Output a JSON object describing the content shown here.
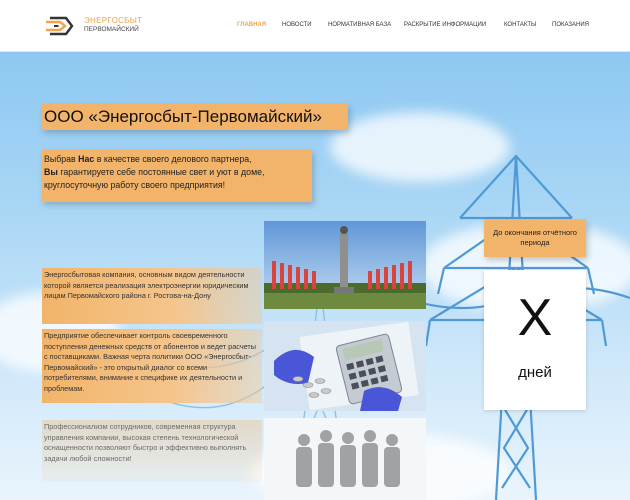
{
  "header": {
    "brand_line1": "ЭНЕРГОСБЫТ",
    "brand_line2": "ПЕРВОМАЙСКИЙ",
    "nav": [
      {
        "label": "ГЛАВНАЯ",
        "active": true
      },
      {
        "label": "НОВОСТИ"
      },
      {
        "label": "НОРМАТИВНАЯ БАЗА"
      },
      {
        "label": "РАСКРЫТИЕ ИНФОРМАЦИИ"
      },
      {
        "label": "КОНТАКТЫ"
      },
      {
        "label": "ПОКАЗАНИЯ"
      }
    ]
  },
  "hero": {
    "title": "ООО «Энергосбыт-Первомайский»",
    "intro": {
      "w1": "Выбрав ",
      "b1": "Нас",
      "w2": " в качестве своего делового партнера,",
      "b2": "Вы",
      "w3": " гарантируете себе постоянные свет и уют в доме, круглосуточную работу своего предприятия!"
    },
    "p1": "Энергосбытовая компания, основным видом деятельности которой является реализация электроэнергии юридическим лицам Первомайского района г. Ростова-на-Дону",
    "p2": "Предприятие обеспечивает контроль своевременного поступления денежных средств от абонентов и ведет расчеты с поставщиками. Важная черта политики ООО «Энергосбыт-Первомайский» - это открытый диалог со всеми потребителями, внимание к специфике их деятельности и проблемам.",
    "p3": "Профессионализм сотрудников, современная структура управления компании, высокая степень технологической оснащенности позволяют быстро и эффективно выполнять задачи любой сложности!"
  },
  "deadline": {
    "label": "До окончания отчётного периода",
    "value": "X",
    "unit": "дней"
  },
  "colors": {
    "accent": "#f2b46a",
    "nav_active": "#f0a44b",
    "sky": "#a9d6f5"
  }
}
